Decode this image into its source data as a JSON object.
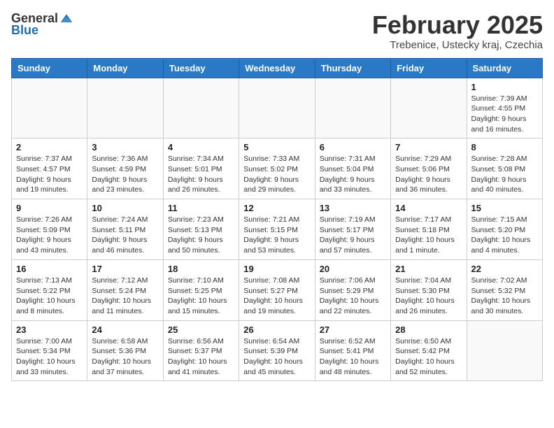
{
  "header": {
    "logo_general": "General",
    "logo_blue": "Blue",
    "month_title": "February 2025",
    "location": "Trebenice, Ustecky kraj, Czechia"
  },
  "weekdays": [
    "Sunday",
    "Monday",
    "Tuesday",
    "Wednesday",
    "Thursday",
    "Friday",
    "Saturday"
  ],
  "weeks": [
    [
      {
        "day": "",
        "info": ""
      },
      {
        "day": "",
        "info": ""
      },
      {
        "day": "",
        "info": ""
      },
      {
        "day": "",
        "info": ""
      },
      {
        "day": "",
        "info": ""
      },
      {
        "day": "",
        "info": ""
      },
      {
        "day": "1",
        "info": "Sunrise: 7:39 AM\nSunset: 4:55 PM\nDaylight: 9 hours and 16 minutes."
      }
    ],
    [
      {
        "day": "2",
        "info": "Sunrise: 7:37 AM\nSunset: 4:57 PM\nDaylight: 9 hours and 19 minutes."
      },
      {
        "day": "3",
        "info": "Sunrise: 7:36 AM\nSunset: 4:59 PM\nDaylight: 9 hours and 23 minutes."
      },
      {
        "day": "4",
        "info": "Sunrise: 7:34 AM\nSunset: 5:01 PM\nDaylight: 9 hours and 26 minutes."
      },
      {
        "day": "5",
        "info": "Sunrise: 7:33 AM\nSunset: 5:02 PM\nDaylight: 9 hours and 29 minutes."
      },
      {
        "day": "6",
        "info": "Sunrise: 7:31 AM\nSunset: 5:04 PM\nDaylight: 9 hours and 33 minutes."
      },
      {
        "day": "7",
        "info": "Sunrise: 7:29 AM\nSunset: 5:06 PM\nDaylight: 9 hours and 36 minutes."
      },
      {
        "day": "8",
        "info": "Sunrise: 7:28 AM\nSunset: 5:08 PM\nDaylight: 9 hours and 40 minutes."
      }
    ],
    [
      {
        "day": "9",
        "info": "Sunrise: 7:26 AM\nSunset: 5:09 PM\nDaylight: 9 hours and 43 minutes."
      },
      {
        "day": "10",
        "info": "Sunrise: 7:24 AM\nSunset: 5:11 PM\nDaylight: 9 hours and 46 minutes."
      },
      {
        "day": "11",
        "info": "Sunrise: 7:23 AM\nSunset: 5:13 PM\nDaylight: 9 hours and 50 minutes."
      },
      {
        "day": "12",
        "info": "Sunrise: 7:21 AM\nSunset: 5:15 PM\nDaylight: 9 hours and 53 minutes."
      },
      {
        "day": "13",
        "info": "Sunrise: 7:19 AM\nSunset: 5:17 PM\nDaylight: 9 hours and 57 minutes."
      },
      {
        "day": "14",
        "info": "Sunrise: 7:17 AM\nSunset: 5:18 PM\nDaylight: 10 hours and 1 minute."
      },
      {
        "day": "15",
        "info": "Sunrise: 7:15 AM\nSunset: 5:20 PM\nDaylight: 10 hours and 4 minutes."
      }
    ],
    [
      {
        "day": "16",
        "info": "Sunrise: 7:13 AM\nSunset: 5:22 PM\nDaylight: 10 hours and 8 minutes."
      },
      {
        "day": "17",
        "info": "Sunrise: 7:12 AM\nSunset: 5:24 PM\nDaylight: 10 hours and 11 minutes."
      },
      {
        "day": "18",
        "info": "Sunrise: 7:10 AM\nSunset: 5:25 PM\nDaylight: 10 hours and 15 minutes."
      },
      {
        "day": "19",
        "info": "Sunrise: 7:08 AM\nSunset: 5:27 PM\nDaylight: 10 hours and 19 minutes."
      },
      {
        "day": "20",
        "info": "Sunrise: 7:06 AM\nSunset: 5:29 PM\nDaylight: 10 hours and 22 minutes."
      },
      {
        "day": "21",
        "info": "Sunrise: 7:04 AM\nSunset: 5:30 PM\nDaylight: 10 hours and 26 minutes."
      },
      {
        "day": "22",
        "info": "Sunrise: 7:02 AM\nSunset: 5:32 PM\nDaylight: 10 hours and 30 minutes."
      }
    ],
    [
      {
        "day": "23",
        "info": "Sunrise: 7:00 AM\nSunset: 5:34 PM\nDaylight: 10 hours and 33 minutes."
      },
      {
        "day": "24",
        "info": "Sunrise: 6:58 AM\nSunset: 5:36 PM\nDaylight: 10 hours and 37 minutes."
      },
      {
        "day": "25",
        "info": "Sunrise: 6:56 AM\nSunset: 5:37 PM\nDaylight: 10 hours and 41 minutes."
      },
      {
        "day": "26",
        "info": "Sunrise: 6:54 AM\nSunset: 5:39 PM\nDaylight: 10 hours and 45 minutes."
      },
      {
        "day": "27",
        "info": "Sunrise: 6:52 AM\nSunset: 5:41 PM\nDaylight: 10 hours and 48 minutes."
      },
      {
        "day": "28",
        "info": "Sunrise: 6:50 AM\nSunset: 5:42 PM\nDaylight: 10 hours and 52 minutes."
      },
      {
        "day": "",
        "info": ""
      }
    ]
  ]
}
